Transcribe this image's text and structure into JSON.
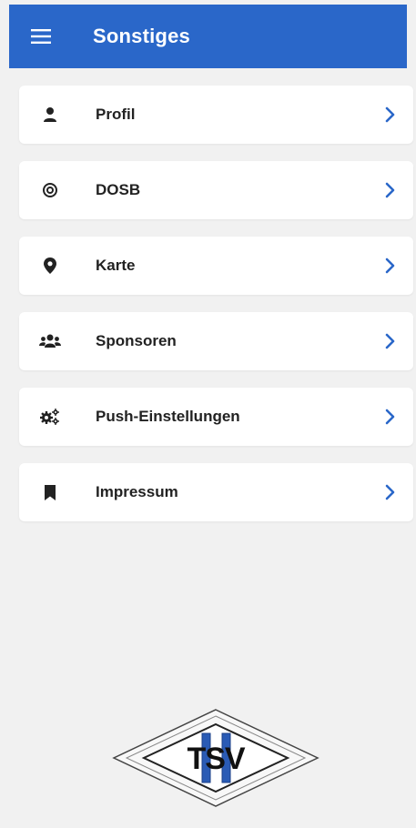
{
  "header": {
    "title": "Sonstiges",
    "menu_icon": "menu-icon"
  },
  "colors": {
    "appbar": "#2a67c9",
    "chevron": "#2a67c9",
    "background": "#f1f1f1",
    "card": "#ffffff",
    "text": "#222222"
  },
  "menu": {
    "items": [
      {
        "label": "Profil",
        "icon": "user-icon"
      },
      {
        "label": "DOSB",
        "icon": "target-icon"
      },
      {
        "label": "Karte",
        "icon": "map-marker-icon"
      },
      {
        "label": "Sponsoren",
        "icon": "users-icon"
      },
      {
        "label": "Push-Einstellungen",
        "icon": "cogs-icon"
      },
      {
        "label": "Impressum",
        "icon": "bookmark-icon"
      }
    ]
  },
  "logo": {
    "text": "TSV",
    "icon": "tsv-logo"
  }
}
